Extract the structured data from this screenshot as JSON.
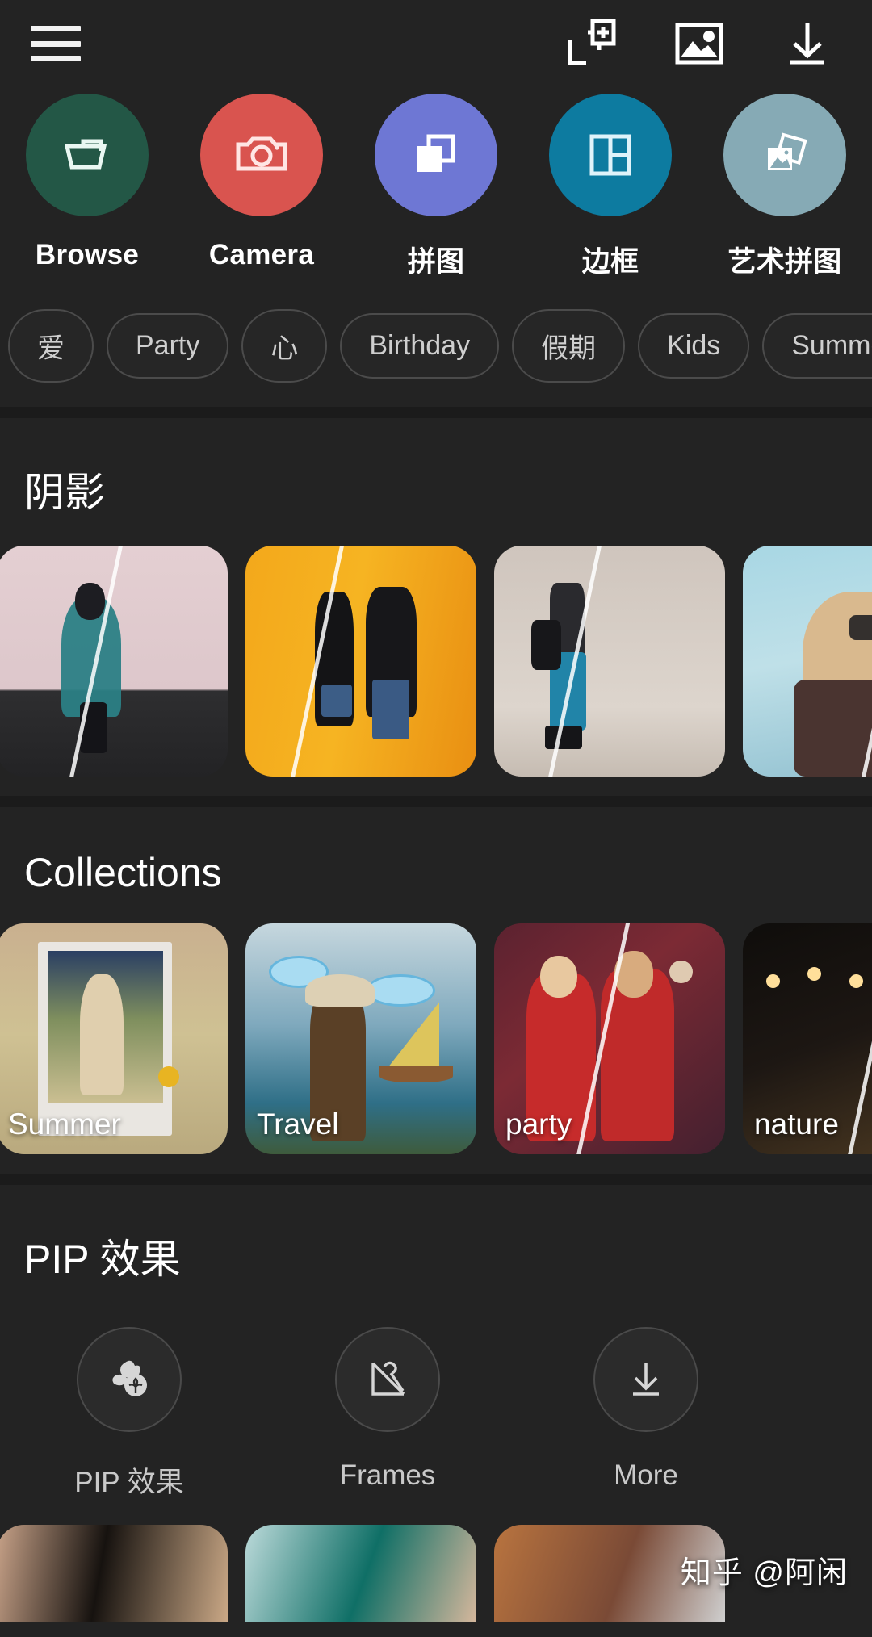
{
  "topbar": {
    "menu_icon": "hamburger-menu-icon",
    "icons": [
      {
        "name": "add-collage-icon",
        "label": "New Collage"
      },
      {
        "name": "image-icon",
        "label": "Gallery"
      },
      {
        "name": "download-icon",
        "label": "Download"
      }
    ]
  },
  "actions": [
    {
      "label": "Browse",
      "icon": "folder-icon",
      "color": "#235746"
    },
    {
      "label": "Camera",
      "icon": "camera-icon",
      "color": "#d9544f"
    },
    {
      "label": "拼图",
      "icon": "collage-icon",
      "color": "#6e77d4"
    },
    {
      "label": "边框",
      "icon": "grid-frame-icon",
      "color": "#0d7ba0"
    },
    {
      "label": "艺术拼图",
      "icon": "art-collage-icon",
      "color": "#86aab5"
    }
  ],
  "tags": [
    "爱",
    "Party",
    "心",
    "Birthday",
    "假期",
    "Kids",
    "Summer"
  ],
  "sections": [
    {
      "title": "阴影",
      "items": [
        {
          "label": "",
          "tone": "shadow-woman-pink-wall"
        },
        {
          "label": "",
          "tone": "shadow-couple-yellow-wall"
        },
        {
          "label": "",
          "tone": "shadow-woman-walking-concrete"
        },
        {
          "label": "",
          "tone": "shadow-woman-phone-blue"
        }
      ]
    },
    {
      "title": "Collections",
      "items": [
        {
          "label": "Summer",
          "tone": "collection-summer-field"
        },
        {
          "label": "Travel",
          "tone": "collection-travel-sea"
        },
        {
          "label": "party",
          "tone": "collection-party-red"
        },
        {
          "label": "nature",
          "tone": "collection-nature-night"
        }
      ]
    }
  ],
  "pip": {
    "title": "PIP 效果",
    "items": [
      {
        "label": "PIP 效果",
        "icon": "flower-pip-icon"
      },
      {
        "label": "Frames",
        "icon": "brush-canvas-icon"
      },
      {
        "label": "More",
        "icon": "download-icon"
      }
    ]
  },
  "watermark": "知乎 @阿闲",
  "colors": {
    "background": "#232323",
    "divider": "#1b1b1b",
    "chip_border": "#4b4b4b",
    "text_primary": "#ffffff",
    "text_secondary": "#c9c9c9"
  }
}
